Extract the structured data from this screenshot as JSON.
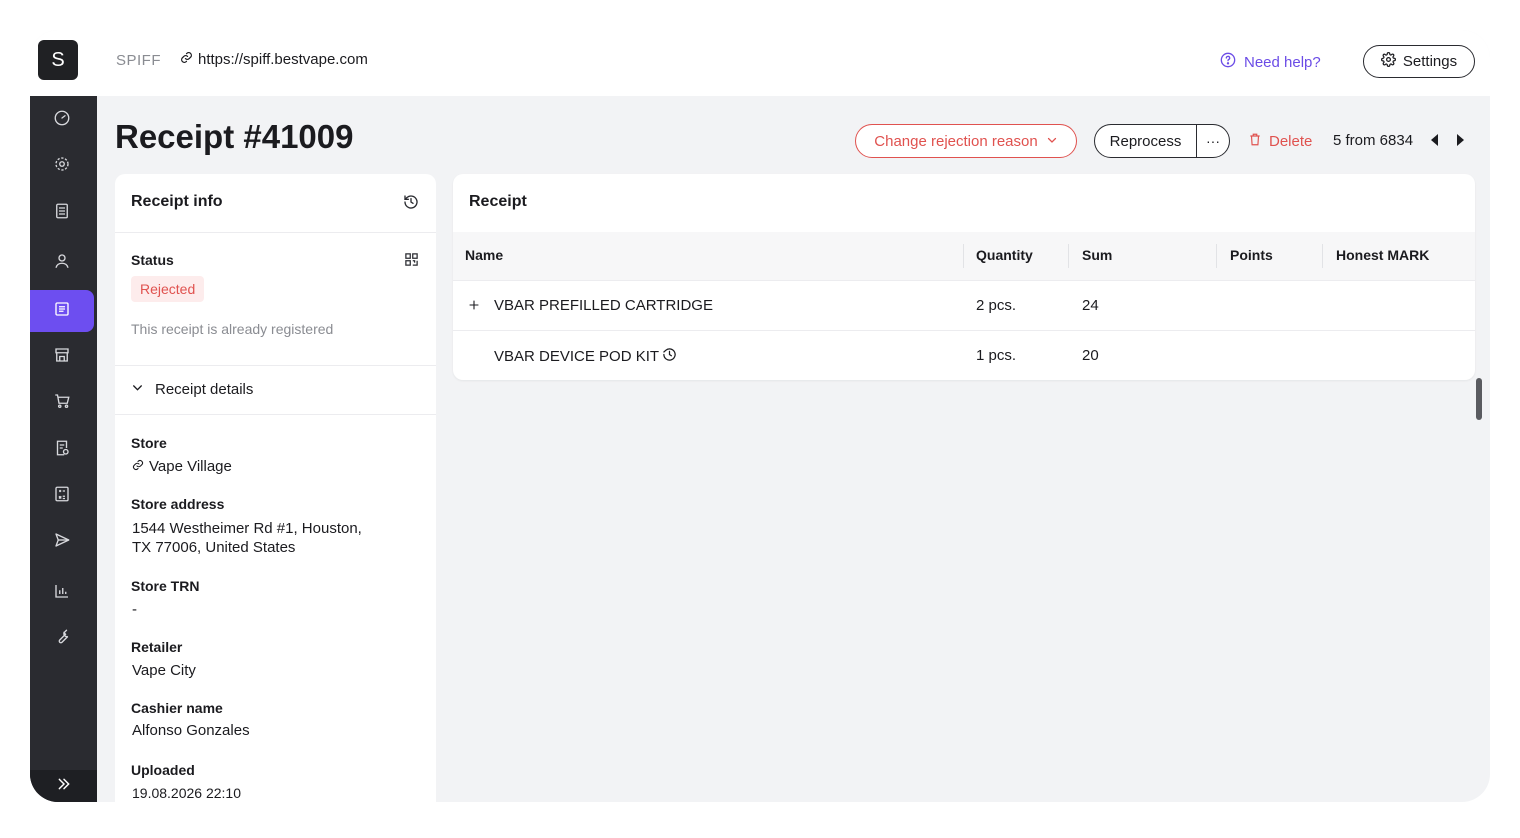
{
  "topbar": {
    "logo_letter": "S",
    "app_name": "SPIFF",
    "url": "https://spiff.bestvape.com",
    "help_label": "Need help?",
    "settings_label": "Settings"
  },
  "sidebar": {
    "items": [
      {
        "icon": "dashboard-gauge-icon",
        "active": false
      },
      {
        "icon": "gear-icon",
        "active": false
      },
      {
        "icon": "list-document-icon",
        "active": false
      },
      {
        "icon": "user-icon",
        "active": false
      },
      {
        "icon": "receipt-list-icon",
        "active": true
      },
      {
        "icon": "store-icon",
        "active": false
      },
      {
        "icon": "cart-icon",
        "active": false
      },
      {
        "icon": "report-document-icon",
        "active": false
      },
      {
        "icon": "calculator-icon",
        "active": false
      },
      {
        "icon": "send-icon",
        "active": false
      },
      {
        "icon": "bar-chart-icon",
        "active": false
      },
      {
        "icon": "wrench-icon",
        "active": false
      }
    ],
    "expand_icon": "double-chevron-right-icon"
  },
  "header": {
    "title": "Receipt #41009",
    "change_reason_label": "Change rejection reason",
    "reprocess_label": "Reprocess",
    "more_label": "···",
    "delete_label": "Delete",
    "pager_text": "5 from 6834"
  },
  "receipt_info": {
    "title": "Receipt info",
    "status_label": "Status",
    "status_value": "Rejected",
    "status_note": "This receipt is already registered",
    "details_toggle": "Receipt details",
    "store_label": "Store",
    "store_value": "Vape Village",
    "address_label": "Store address",
    "address_line1": "1544 Westheimer Rd #1, Houston,",
    "address_line2": "TX 77006, United States",
    "trn_label": "Store TRN",
    "trn_value": "-",
    "retailer_label": "Retailer",
    "retailer_value": "Vape City",
    "cashier_label": "Cashier name",
    "cashier_value": "Alfonso Gonzales",
    "uploaded_label": "Uploaded",
    "uploaded_value": "19.08.2026 22:10"
  },
  "receipt_table": {
    "title": "Receipt",
    "columns": [
      "Name",
      "Quantity",
      "Sum",
      "Points",
      "Honest MARK"
    ],
    "rows": [
      {
        "name": "VBAR PREFILLED CARTRIDGE",
        "quantity": "2 pcs.",
        "sum": "24",
        "points": "",
        "mark": ""
      },
      {
        "name": "VBAR DEVICE POD KIT",
        "quantity": "1 pcs.",
        "sum": "20",
        "points": "",
        "mark": ""
      }
    ]
  },
  "colors": {
    "accent": "#6d4ef0",
    "danger": "#e0524f",
    "sidebar_bg": "#2a2b30"
  }
}
